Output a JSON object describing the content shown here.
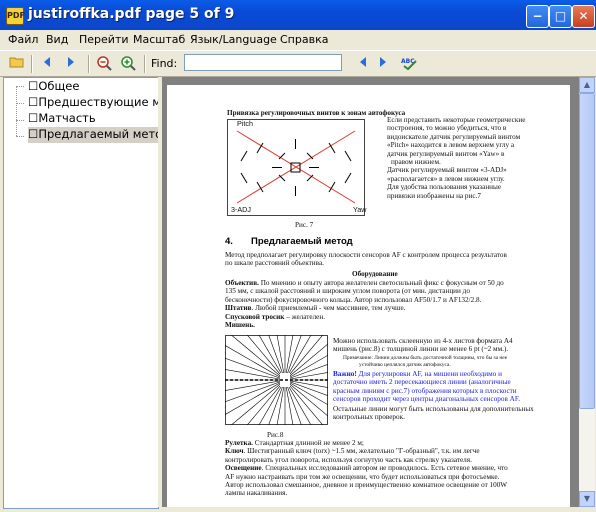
{
  "window": {
    "title": "justiroffka.pdf page 5 of 9",
    "app_icon_text": "PDF",
    "minimize": "−",
    "maximize": "□",
    "close": "✕"
  },
  "menu": [
    "Файл",
    "Вид",
    "Перейти",
    "Масштаб",
    "Язык/Language",
    "Справка"
  ],
  "toolbar": {
    "find_label": "Find:",
    "find_value": "",
    "spell_icon_text": "ABC"
  },
  "sidebar": {
    "items": [
      "Общее",
      "Предшествующие мето",
      "Матчасть",
      "Предлагаемый метод"
    ],
    "selected_index": 3
  },
  "document": {
    "section1_title": "Привязка регулировочных винтов к зонам автофокуса",
    "section1_text": [
      "Если представить некоторые геометрические",
      "построения, то можно убедиться, что в",
      "видоискателе датчик регулируемый винтом",
      "«Pitch» находится в левом верхнем углу а",
      "датчик регулируемый винтом «Yaw» в",
      "правом нижнем.",
      "Датчик регулируемый винтом «3-ADJ»",
      "«располагается» в левом нижнем углу.",
      "Для удобства пользования указанные",
      "привязки изображены на рис.7"
    ],
    "fig7": {
      "pitch": "Pitch",
      "adj": "3-ADJ",
      "yaw": "Yaw",
      "caption": "Рис. 7"
    },
    "section4_number": "4.",
    "section4_title": "Предлагаемый метод",
    "intro": [
      "Метод предполагает регулировку плоскости сенсоров AF с контролем процесса результатов",
      "по шкале расстояний объектива."
    ],
    "equipment_heading": "Оборудование",
    "equipment": [
      {
        "label": "Объектив.",
        "text": " По мнению и опыту автора желателен светосильный  фикс с фокусным от 50 до"
      },
      {
        "label": "",
        "text": "135 мм, с шкалой расстояний и широким углом поворота (от мин. дистанции до"
      },
      {
        "label": "",
        "text": "бесконечности) фокусировочного кольца. Автор использовал AF50/1.7 и AF132/2.8."
      },
      {
        "label": "Штатив",
        "text": ". Любой приемлемый - чем массивнее, тем лучше."
      },
      {
        "label": "Спусковой тросик",
        "text": " – желателен."
      },
      {
        "label": "Мишень.",
        "text": ""
      }
    ],
    "target_text": [
      "Можно использовать склеенную из 4-х листов формата А4",
      "мишень (рис.8) с толщиной линии не менее 6 pt (~2 мм.)."
    ],
    "target_note": [
      "Примечание: Линии должны быть достаточной толщины, что бы за нее",
      "устойчиво цеплялся датчик автофокуса."
    ],
    "important_label": "Важно!",
    "important_lines": [
      " Для регулировки AF, на мишени необходимо  и",
      "достаточно иметь 2 пересекающиеся линии  (аналогичные",
      "красным линиям с рис.7) отображения которых  в плоскости",
      "сенсоров проходит через центры диагональных сенсоров AF."
    ],
    "other_lines": [
      " Остальные линии могут быть использованы для дополнительных",
      "контрольных проверок."
    ],
    "fig8_caption": "Рис.8",
    "bottom": [
      {
        "label": "Рулетка.",
        "text": " Стандартная длинной не менее 2 м;"
      },
      {
        "label": "Ключ",
        "text": ". Шестигранный ключ (torx) ~1.5 мм, желательно \"Г-образный\", т.к. им легче"
      },
      {
        "label": "",
        "text": "контролировать угол поворота, используя согнутую часть как стрелку указателя."
      },
      {
        "label": "Освещение",
        "text": ". Специальных исследований автором не проводилось. Есть сетевое мнение, что"
      },
      {
        "label": "",
        "text": "AF нужно настраивать при том же освещении, что будет использоваться при фотосъемке."
      },
      {
        "label": "",
        "text": "Автор использовал смешанное, дневное и преимущественно комнатное освещение от 100W"
      },
      {
        "label": "",
        "text": "лампы накаливания."
      }
    ]
  },
  "colors": {
    "titlebar": "#0a4ad8",
    "red_lines": "#e03a2a",
    "blue_text": "#1a1ad6"
  }
}
